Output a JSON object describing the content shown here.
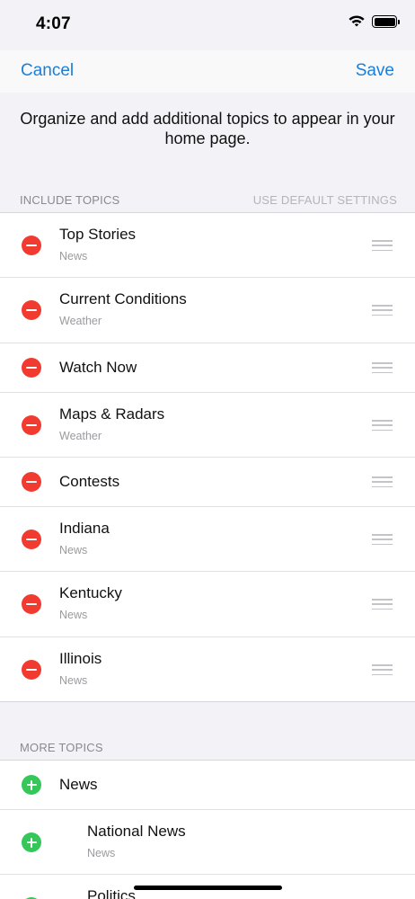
{
  "status_bar": {
    "time": "4:07"
  },
  "nav": {
    "cancel_label": "Cancel",
    "save_label": "Save"
  },
  "intro_text": "Organize and add additional topics to appear in your home page.",
  "include_section": {
    "header": "INCLUDE TOPICS",
    "default_link": "USE DEFAULT SETTINGS",
    "items": [
      {
        "title": "Top Stories",
        "subtitle": "News"
      },
      {
        "title": "Current Conditions",
        "subtitle": "Weather"
      },
      {
        "title": "Watch Now",
        "subtitle": ""
      },
      {
        "title": "Maps & Radars",
        "subtitle": "Weather"
      },
      {
        "title": "Contests",
        "subtitle": ""
      },
      {
        "title": "Indiana",
        "subtitle": "News"
      },
      {
        "title": "Kentucky",
        "subtitle": "News"
      },
      {
        "title": "Illinois",
        "subtitle": "News"
      }
    ]
  },
  "more_section": {
    "header": "MORE TOPICS",
    "items": [
      {
        "title": "News",
        "subtitle": ""
      },
      {
        "title": "National News",
        "subtitle": "News"
      },
      {
        "title": "Politics",
        "subtitle": ""
      }
    ]
  },
  "icons": {
    "remove": "minus-circle-icon",
    "add": "plus-circle-icon",
    "reorder": "drag-handle-icon",
    "remove_color": "#f23b30",
    "add_color": "#34c759",
    "accent_color": "#1a7fd8"
  }
}
